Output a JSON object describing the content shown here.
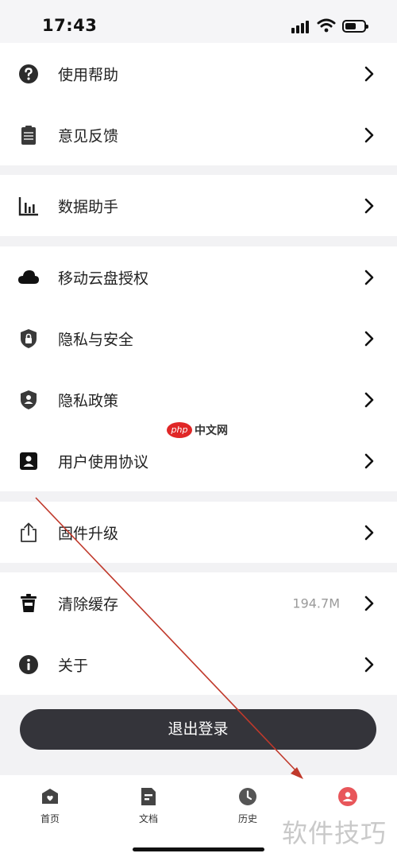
{
  "status_bar": {
    "time": "17:43"
  },
  "menu": {
    "group1": [
      {
        "label": "使用帮助",
        "icon": "help-circle-icon"
      },
      {
        "label": "意见反馈",
        "icon": "clipboard-icon"
      }
    ],
    "group2": [
      {
        "label": "数据助手",
        "icon": "bar-chart-icon"
      }
    ],
    "group3": [
      {
        "label": "移动云盘授权",
        "icon": "cloud-icon"
      },
      {
        "label": "隐私与安全",
        "icon": "shield-lock-icon"
      },
      {
        "label": "隐私政策",
        "icon": "shield-user-icon"
      },
      {
        "label": "用户使用协议",
        "icon": "contact-card-icon"
      }
    ],
    "group4": [
      {
        "label": "固件升级",
        "icon": "share-upload-icon"
      }
    ],
    "group5": [
      {
        "label": "清除缓存",
        "value": "194.7M",
        "icon": "trash-icon"
      },
      {
        "label": "关于",
        "icon": "info-icon"
      }
    ]
  },
  "logout_label": "退出登录",
  "tabs": [
    {
      "label": "首页",
      "icon": "home-icon"
    },
    {
      "label": "文档",
      "icon": "document-icon"
    },
    {
      "label": "历史",
      "icon": "clock-icon"
    },
    {
      "label": "",
      "icon": "profile-icon",
      "active": true
    }
  ],
  "watermark": {
    "center_logo": "php",
    "center_text": "中文网",
    "corner_text": "软件技巧"
  },
  "colors": {
    "accent": "#e8565a",
    "logout_bg": "#34343a",
    "arrow": "#c0392b"
  }
}
